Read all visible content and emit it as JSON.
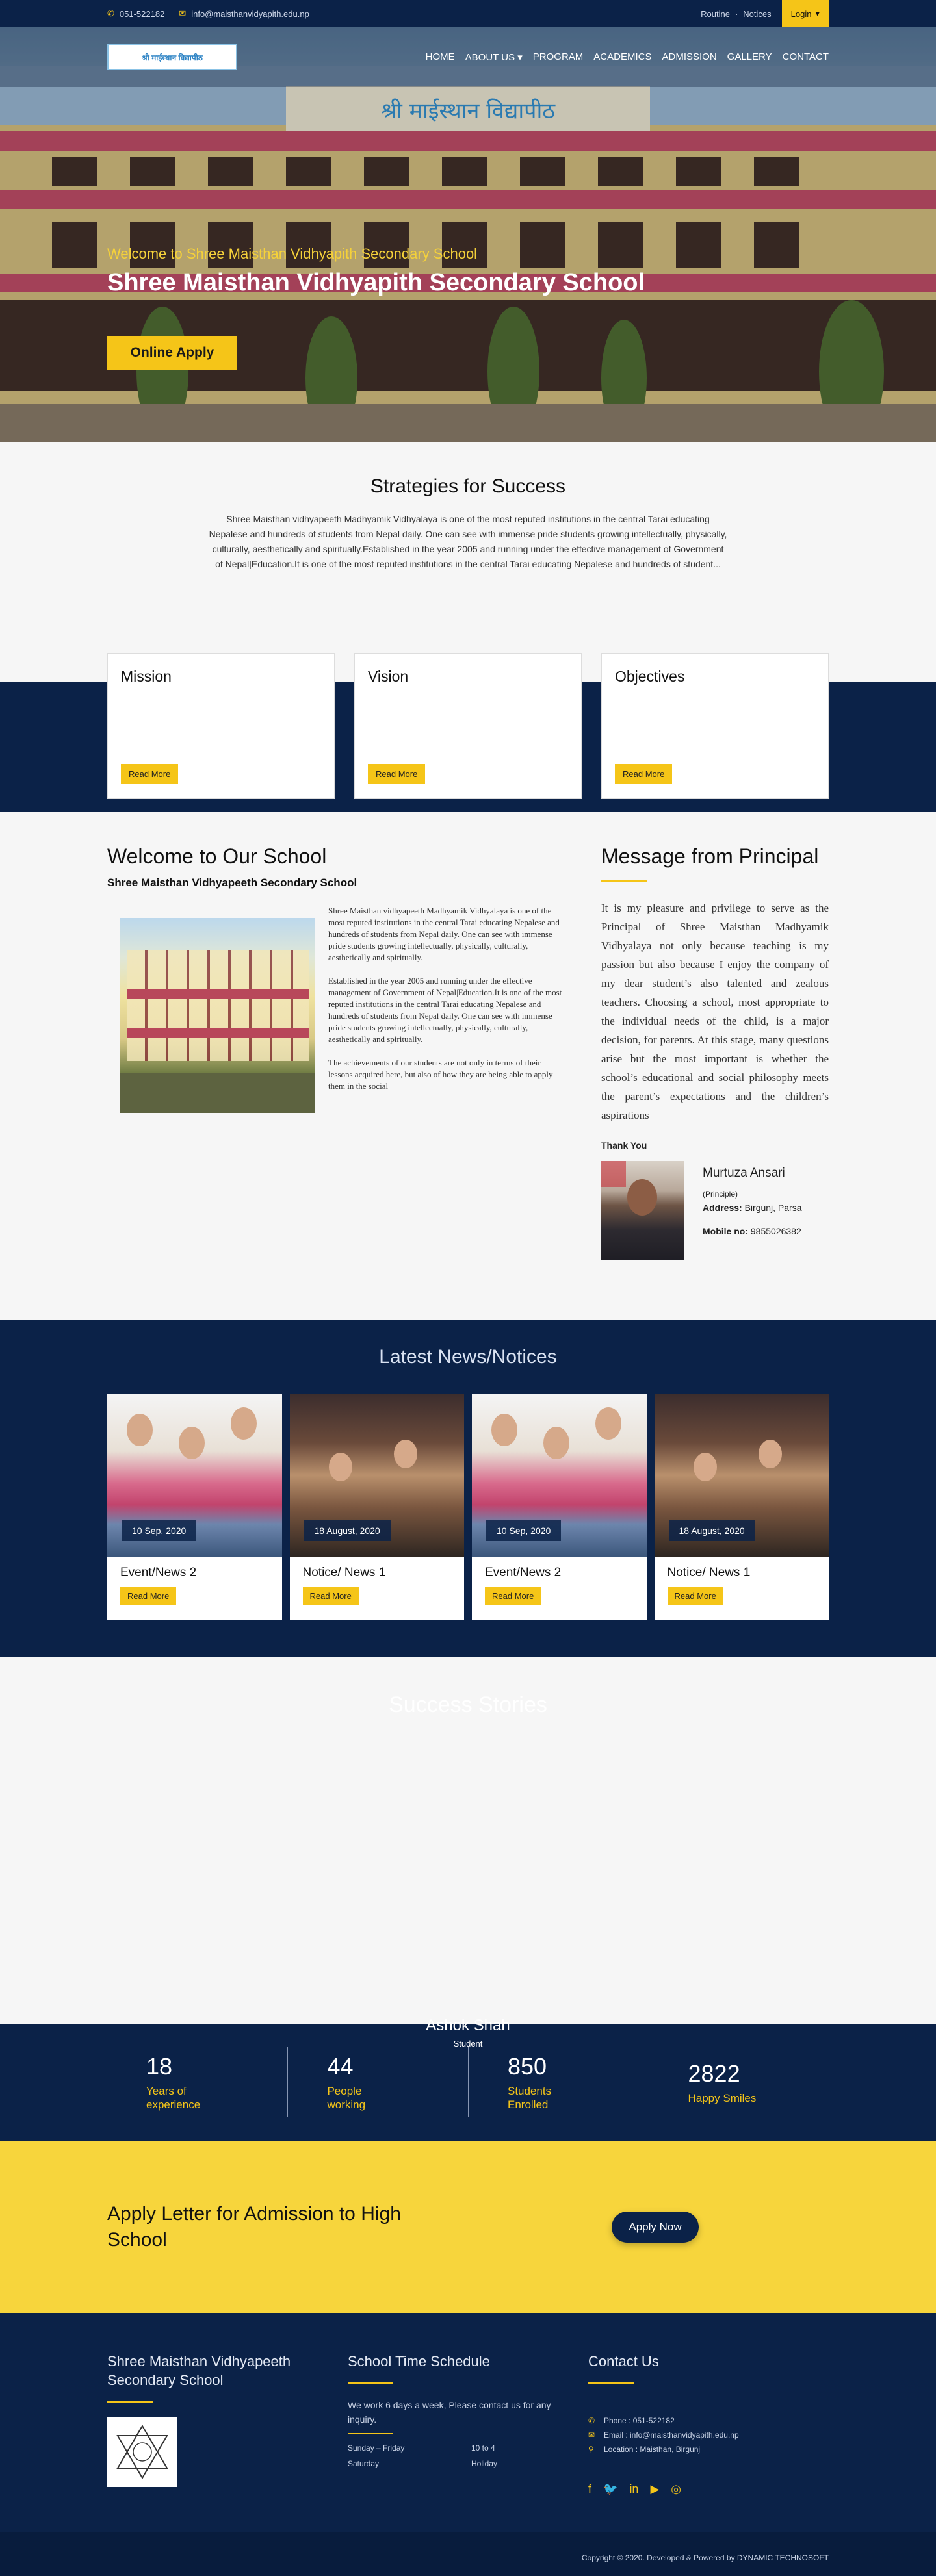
{
  "topbar": {
    "phone": "051-522182",
    "email": "info@maisthanvidyapith.edu.np",
    "links": [
      "Routine",
      "Notices"
    ],
    "login": "Login"
  },
  "nav": {
    "logo_text": "श्री माईस्थान विद्यापीठ",
    "items": [
      "HOME",
      "ABOUT US",
      "PROGRAM",
      "ACADEMICS",
      "ADMISSION",
      "GALLERY",
      "CONTACT"
    ]
  },
  "hero": {
    "subtitle": "Welcome to Shree Maisthan Vidhyapith Secondary School",
    "title": "Shree Maisthan Vidhyapith Secondary School",
    "apply": "Online Apply"
  },
  "strategies": {
    "title": "Strategies for Success",
    "text": "Shree Maisthan vidhyapeeth Madhyamik Vidhyalaya is one of the most reputed institutions in the central Tarai educating Nepalese and hundreds of students from Nepal daily. One can see with immense pride students growing intellectually, physically, culturally, aesthetically and spiritually.Established in the year 2005 and running under the effective management of Government of Nepal|Education.It is one of the most reputed institutions in the central Tarai educating Nepalese and hundreds of student..."
  },
  "cards": [
    {
      "title": "Mission",
      "button": "Read More"
    },
    {
      "title": "Vision",
      "button": "Read More"
    },
    {
      "title": "Objectives",
      "button": "Read More"
    }
  ],
  "welcome": {
    "title": "Welcome to Our School",
    "subtitle": "Shree Maisthan Vidhyapeeth Secondary School",
    "p1": "Shree Maisthan vidhyapeeth Madhyamik Vidhyalaya is one of the most reputed institutions in the central Tarai educating Nepalese and hundreds of students from Nepal daily. One can see with immense pride students growing intellectually, physically, culturally, aesthetically and spiritually.",
    "p2": "Established in the year 2005 and running under the effective management of Government of Nepal|Education.It is one of the most reputed institutions in the central Tarai educating Nepalese and hundreds of students from Nepal daily. One can see with immense pride students growing intellectually, physically, culturally, aesthetically and spiritually.",
    "p3": "The achievements of our students are not only in terms of their lessons acquired here, but also of how they are being able to apply them in the social"
  },
  "principal": {
    "title": "Message from Principal",
    "message": "It is my pleasure and privilege to serve as the Principal of Shree Maisthan Madhyamik Vidhyalaya not only because teaching is my passion but also because I enjoy the company of my dear student’s also talented and zealous teachers. Choosing a school, most appropriate to the individual needs of the child, is a major decision, for parents. At this stage, many questions arise but the most important is whether the school’s educational and social philosophy meets the parent’s expectations and the children’s aspirations",
    "thanks": "Thank You",
    "name": "Murtuza Ansari",
    "role": "(Principle)",
    "address_label": "Address:",
    "address": "Birgunj, Parsa",
    "mobile_label": "Mobile no:",
    "mobile": "9855026382"
  },
  "news": {
    "title": "Latest News/Notices",
    "items": [
      {
        "date": "10 Sep, 2020",
        "title": "Event/News 2",
        "button": "Read More",
        "image": "students-photo"
      },
      {
        "date": "18 August, 2020",
        "title": "Notice/ News 1",
        "button": "Read More",
        "image": "classroom-photo"
      },
      {
        "date": "10 Sep, 2020",
        "title": "Event/News 2",
        "button": "Read More",
        "image": "students-photo"
      },
      {
        "date": "18 August, 2020",
        "title": "Notice/ News 1",
        "button": "Read More",
        "image": "classroom-photo"
      }
    ]
  },
  "success": {
    "title": "Success Stories",
    "name": "Ashok Shah",
    "role": "Student"
  },
  "stats": [
    {
      "number": "18",
      "label": "Years of experience"
    },
    {
      "number": "44",
      "label": "People working"
    },
    {
      "number": "850",
      "label": "Students Enrolled"
    },
    {
      "number": "2822",
      "label": "Happy Smiles"
    }
  ],
  "admission": {
    "title": "Apply Letter for Admission to High School",
    "button": "Apply Now"
  },
  "footer": {
    "school_title": "Shree Maisthan Vidhyapeeth Secondary School",
    "schedule_title": "School Time Schedule",
    "schedule_text": "We work 6 days a week, Please contact us for any inquiry.",
    "schedule": [
      {
        "day": "Sunday – Friday",
        "time": "10 to 4"
      },
      {
        "day": "Saturday",
        "time": "Holiday"
      }
    ],
    "contact_title": "Contact Us",
    "phone": "Phone : 051-522182",
    "email": "Email : info@maisthanvidyapith.edu.np",
    "location": "Location : Maisthan, Birgunj",
    "copyright": "Copyright © 2020. Developed & Powered by DYNAMIC TECHNOSOFT"
  },
  "colors": {
    "navy": "#0b2248",
    "accent": "#f5c518"
  }
}
